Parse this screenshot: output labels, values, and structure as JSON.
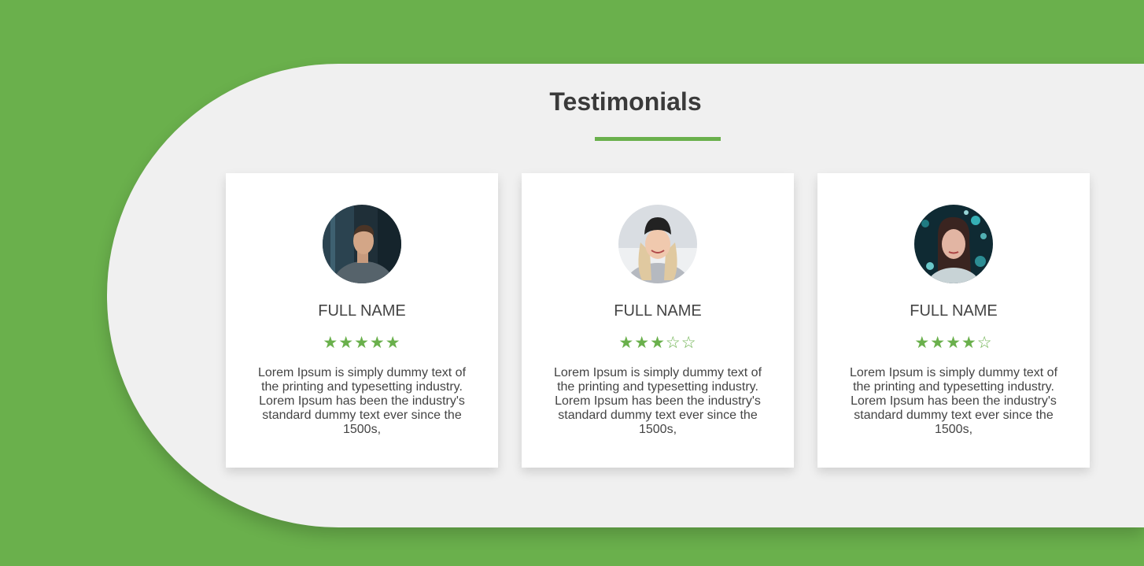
{
  "section": {
    "title": "Testimonials"
  },
  "colors": {
    "accent": "#6ab04c",
    "panel": "#f0f0f0",
    "card": "#ffffff",
    "text": "#444444"
  },
  "testimonials": [
    {
      "name": "FULL NAME",
      "rating": 5,
      "max_rating": 5,
      "avatar": "man-portrait-avatar",
      "text": "Lorem Ipsum is simply dummy text of the printing and typesetting industry. Lorem Ipsum has been the industry's standard dummy text ever since the 1500s,"
    },
    {
      "name": "FULL NAME",
      "rating": 3,
      "max_rating": 5,
      "avatar": "woman-beanie-avatar",
      "text": "Lorem Ipsum is simply dummy text of the printing and typesetting industry. Lorem Ipsum has been the industry's standard dummy text ever since the 1500s,"
    },
    {
      "name": "FULL NAME",
      "rating": 4,
      "max_rating": 5,
      "avatar": "woman-lights-avatar",
      "text": "Lorem Ipsum is simply dummy text of the printing and typesetting industry. Lorem Ipsum has been the industry's standard dummy text ever since the 1500s,"
    }
  ]
}
